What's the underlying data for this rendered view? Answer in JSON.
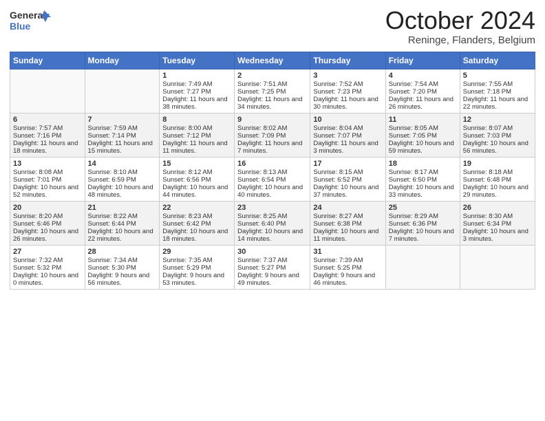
{
  "logo": {
    "line1": "General",
    "line2": "Blue"
  },
  "header": {
    "month": "October 2024",
    "location": "Reninge, Flanders, Belgium"
  },
  "weekdays": [
    "Sunday",
    "Monday",
    "Tuesday",
    "Wednesday",
    "Thursday",
    "Friday",
    "Saturday"
  ],
  "weeks": [
    [
      {
        "day": "",
        "sunrise": "",
        "sunset": "",
        "daylight": ""
      },
      {
        "day": "",
        "sunrise": "",
        "sunset": "",
        "daylight": ""
      },
      {
        "day": "1",
        "sunrise": "Sunrise: 7:49 AM",
        "sunset": "Sunset: 7:27 PM",
        "daylight": "Daylight: 11 hours and 38 minutes."
      },
      {
        "day": "2",
        "sunrise": "Sunrise: 7:51 AM",
        "sunset": "Sunset: 7:25 PM",
        "daylight": "Daylight: 11 hours and 34 minutes."
      },
      {
        "day": "3",
        "sunrise": "Sunrise: 7:52 AM",
        "sunset": "Sunset: 7:23 PM",
        "daylight": "Daylight: 11 hours and 30 minutes."
      },
      {
        "day": "4",
        "sunrise": "Sunrise: 7:54 AM",
        "sunset": "Sunset: 7:20 PM",
        "daylight": "Daylight: 11 hours and 26 minutes."
      },
      {
        "day": "5",
        "sunrise": "Sunrise: 7:55 AM",
        "sunset": "Sunset: 7:18 PM",
        "daylight": "Daylight: 11 hours and 22 minutes."
      }
    ],
    [
      {
        "day": "6",
        "sunrise": "Sunrise: 7:57 AM",
        "sunset": "Sunset: 7:16 PM",
        "daylight": "Daylight: 11 hours and 18 minutes."
      },
      {
        "day": "7",
        "sunrise": "Sunrise: 7:59 AM",
        "sunset": "Sunset: 7:14 PM",
        "daylight": "Daylight: 11 hours and 15 minutes."
      },
      {
        "day": "8",
        "sunrise": "Sunrise: 8:00 AM",
        "sunset": "Sunset: 7:12 PM",
        "daylight": "Daylight: 11 hours and 11 minutes."
      },
      {
        "day": "9",
        "sunrise": "Sunrise: 8:02 AM",
        "sunset": "Sunset: 7:09 PM",
        "daylight": "Daylight: 11 hours and 7 minutes."
      },
      {
        "day": "10",
        "sunrise": "Sunrise: 8:04 AM",
        "sunset": "Sunset: 7:07 PM",
        "daylight": "Daylight: 11 hours and 3 minutes."
      },
      {
        "day": "11",
        "sunrise": "Sunrise: 8:05 AM",
        "sunset": "Sunset: 7:05 PM",
        "daylight": "Daylight: 10 hours and 59 minutes."
      },
      {
        "day": "12",
        "sunrise": "Sunrise: 8:07 AM",
        "sunset": "Sunset: 7:03 PM",
        "daylight": "Daylight: 10 hours and 56 minutes."
      }
    ],
    [
      {
        "day": "13",
        "sunrise": "Sunrise: 8:08 AM",
        "sunset": "Sunset: 7:01 PM",
        "daylight": "Daylight: 10 hours and 52 minutes."
      },
      {
        "day": "14",
        "sunrise": "Sunrise: 8:10 AM",
        "sunset": "Sunset: 6:59 PM",
        "daylight": "Daylight: 10 hours and 48 minutes."
      },
      {
        "day": "15",
        "sunrise": "Sunrise: 8:12 AM",
        "sunset": "Sunset: 6:56 PM",
        "daylight": "Daylight: 10 hours and 44 minutes."
      },
      {
        "day": "16",
        "sunrise": "Sunrise: 8:13 AM",
        "sunset": "Sunset: 6:54 PM",
        "daylight": "Daylight: 10 hours and 40 minutes."
      },
      {
        "day": "17",
        "sunrise": "Sunrise: 8:15 AM",
        "sunset": "Sunset: 6:52 PM",
        "daylight": "Daylight: 10 hours and 37 minutes."
      },
      {
        "day": "18",
        "sunrise": "Sunrise: 8:17 AM",
        "sunset": "Sunset: 6:50 PM",
        "daylight": "Daylight: 10 hours and 33 minutes."
      },
      {
        "day": "19",
        "sunrise": "Sunrise: 8:18 AM",
        "sunset": "Sunset: 6:48 PM",
        "daylight": "Daylight: 10 hours and 29 minutes."
      }
    ],
    [
      {
        "day": "20",
        "sunrise": "Sunrise: 8:20 AM",
        "sunset": "Sunset: 6:46 PM",
        "daylight": "Daylight: 10 hours and 26 minutes."
      },
      {
        "day": "21",
        "sunrise": "Sunrise: 8:22 AM",
        "sunset": "Sunset: 6:44 PM",
        "daylight": "Daylight: 10 hours and 22 minutes."
      },
      {
        "day": "22",
        "sunrise": "Sunrise: 8:23 AM",
        "sunset": "Sunset: 6:42 PM",
        "daylight": "Daylight: 10 hours and 18 minutes."
      },
      {
        "day": "23",
        "sunrise": "Sunrise: 8:25 AM",
        "sunset": "Sunset: 6:40 PM",
        "daylight": "Daylight: 10 hours and 14 minutes."
      },
      {
        "day": "24",
        "sunrise": "Sunrise: 8:27 AM",
        "sunset": "Sunset: 6:38 PM",
        "daylight": "Daylight: 10 hours and 11 minutes."
      },
      {
        "day": "25",
        "sunrise": "Sunrise: 8:29 AM",
        "sunset": "Sunset: 6:36 PM",
        "daylight": "Daylight: 10 hours and 7 minutes."
      },
      {
        "day": "26",
        "sunrise": "Sunrise: 8:30 AM",
        "sunset": "Sunset: 6:34 PM",
        "daylight": "Daylight: 10 hours and 3 minutes."
      }
    ],
    [
      {
        "day": "27",
        "sunrise": "Sunrise: 7:32 AM",
        "sunset": "Sunset: 5:32 PM",
        "daylight": "Daylight: 10 hours and 0 minutes."
      },
      {
        "day": "28",
        "sunrise": "Sunrise: 7:34 AM",
        "sunset": "Sunset: 5:30 PM",
        "daylight": "Daylight: 9 hours and 56 minutes."
      },
      {
        "day": "29",
        "sunrise": "Sunrise: 7:35 AM",
        "sunset": "Sunset: 5:29 PM",
        "daylight": "Daylight: 9 hours and 53 minutes."
      },
      {
        "day": "30",
        "sunrise": "Sunrise: 7:37 AM",
        "sunset": "Sunset: 5:27 PM",
        "daylight": "Daylight: 9 hours and 49 minutes."
      },
      {
        "day": "31",
        "sunrise": "Sunrise: 7:39 AM",
        "sunset": "Sunset: 5:25 PM",
        "daylight": "Daylight: 9 hours and 46 minutes."
      },
      {
        "day": "",
        "sunrise": "",
        "sunset": "",
        "daylight": ""
      },
      {
        "day": "",
        "sunrise": "",
        "sunset": "",
        "daylight": ""
      }
    ]
  ]
}
